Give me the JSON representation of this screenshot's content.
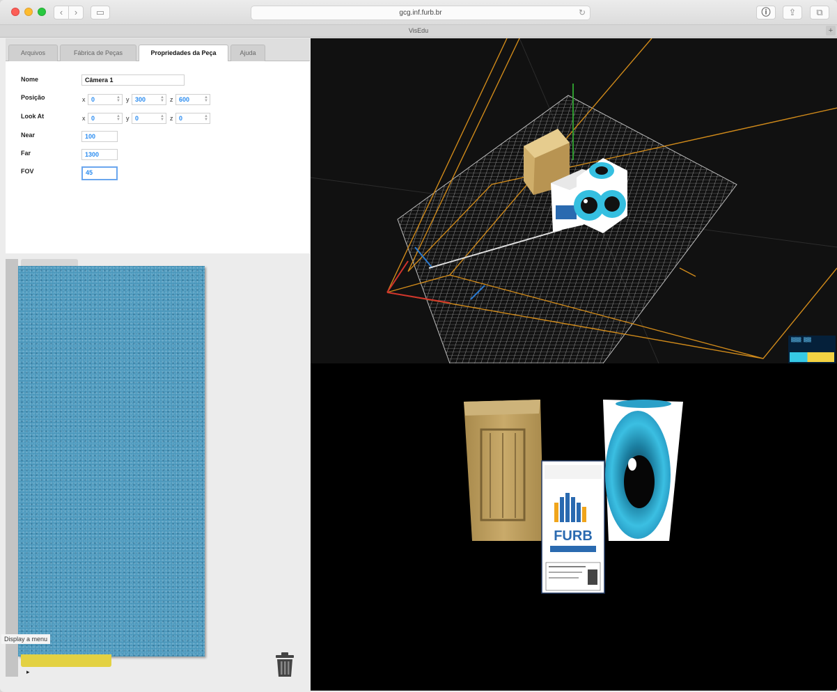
{
  "browser": {
    "address": "gcg.inf.furb.br",
    "tab_title": "VisEdu",
    "back_icon": "chevron-left-icon",
    "forward_icon": "chevron-right-icon",
    "sidebar_icon": "sidebar-icon",
    "info_icon": "info-icon",
    "share_icon": "share-icon",
    "tabs_icon": "tabs-icon",
    "reload_icon": "reload-icon",
    "newtab_label": "+"
  },
  "tabs": [
    {
      "label": "Arquivos",
      "active": false
    },
    {
      "label": "Fábrica de Peças",
      "active": false
    },
    {
      "label": "Propriedades da Peça",
      "active": true
    },
    {
      "label": "Ajuda",
      "active": false
    }
  ],
  "properties": {
    "name_label": "Nome",
    "name_value": "Câmera 1",
    "position_label": "Posição",
    "position": {
      "x": "0",
      "y": "300",
      "z": "600"
    },
    "lookat_label": "Look At",
    "lookat": {
      "x": "0",
      "y": "0",
      "z": "0"
    },
    "near_label": "Near",
    "near_value": "100",
    "far_label": "Far",
    "far_value": "1300",
    "fov_label": "FOV",
    "fov_value": "45",
    "axis_x": "x",
    "axis_y": "y",
    "axis_z": "z"
  },
  "bottom_bar": {
    "display_menu": "Display a menu",
    "trash_icon": "trash-icon"
  },
  "scene": {
    "colors": {
      "crate": "#c9a86a",
      "eye_blue": "#2cb6d8",
      "grid": "#cfcfcf",
      "frustum": "#d08a1a",
      "axis_y": "#2e9a2e",
      "axis_x": "#d0342c",
      "axis_z": "#2a7ad0"
    },
    "box_logo": "FURB"
  }
}
